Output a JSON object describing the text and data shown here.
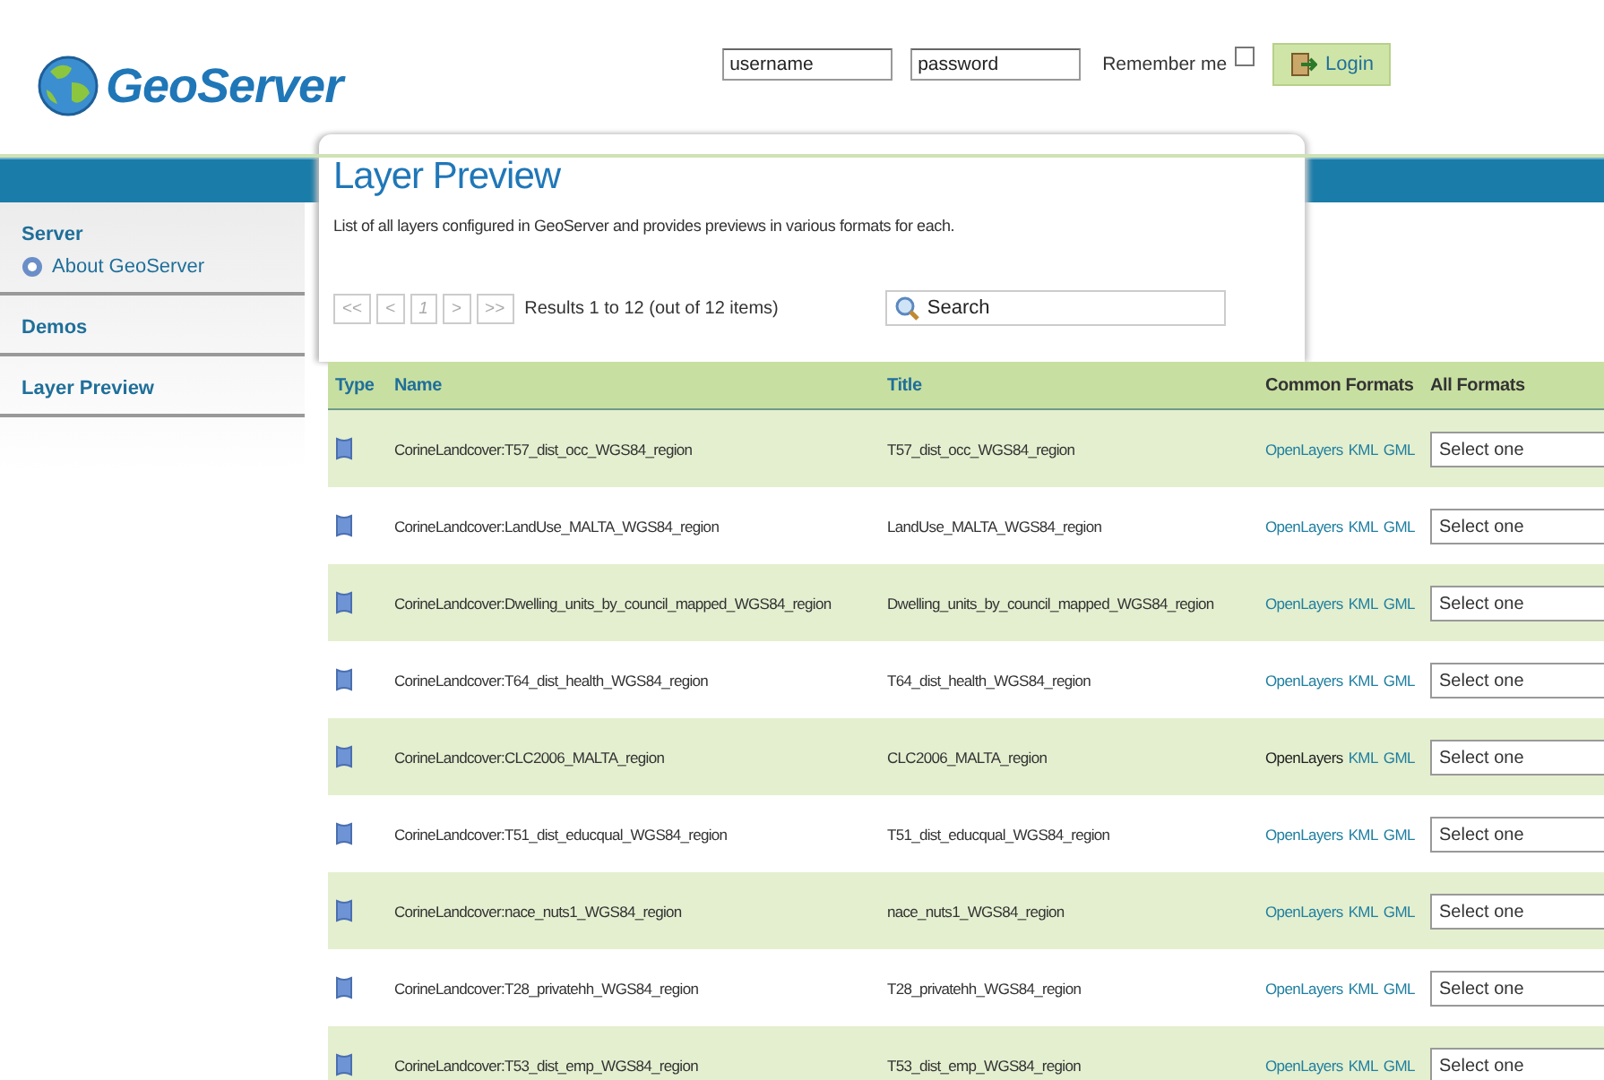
{
  "logo": {
    "text": "GeoServer"
  },
  "login": {
    "username": {
      "placeholder": "username"
    },
    "password": {
      "placeholder": "password"
    },
    "remember": {
      "label": "Remember me",
      "checked": false
    },
    "button": "Login"
  },
  "sidebar": {
    "sections": [
      {
        "title": "Server",
        "items": [
          {
            "label": "About GeoServer"
          }
        ]
      },
      {
        "title": "Demos"
      },
      {
        "title": "Layer Preview"
      }
    ]
  },
  "page": {
    "title": "Layer Preview",
    "description": "List of all layers configured in GeoServer and provides previews in various formats for each."
  },
  "pager": {
    "buttons": [
      {
        "label": "<<",
        "disabled": true
      },
      {
        "label": "<",
        "disabled": true
      },
      {
        "label": "1",
        "disabled": true
      },
      {
        "label": ">",
        "disabled": true
      },
      {
        "label": ">>",
        "disabled": true
      }
    ],
    "summary": "Results 1 to 12 (out of 12 items)"
  },
  "search": {
    "placeholder": "Search"
  },
  "table": {
    "columns": [
      {
        "label": "Type",
        "kind": "link"
      },
      {
        "label": "Name",
        "kind": "link"
      },
      {
        "label": "Title",
        "kind": "link"
      },
      {
        "label": "Common Formats",
        "kind": "label"
      },
      {
        "label": "All Formats",
        "kind": "label"
      }
    ],
    "rows": [
      {
        "name": "CorineLandcover:T57_dist_occ_WGS84_region",
        "title": "T57_dist_occ_WGS84_region",
        "formats": [
          {
            "label": "OpenLayers",
            "disabled": false
          },
          {
            "label": "KML",
            "disabled": false
          },
          {
            "label": "GML",
            "disabled": false
          }
        ],
        "select": "Select one"
      },
      {
        "name": "CorineLandcover:LandUse_MALTA_WGS84_region",
        "title": "LandUse_MALTA_WGS84_region",
        "formats": [
          {
            "label": "OpenLayers",
            "disabled": false
          },
          {
            "label": "KML",
            "disabled": false
          },
          {
            "label": "GML",
            "disabled": false
          }
        ],
        "select": "Select one"
      },
      {
        "name": "CorineLandcover:Dwelling_units_by_council_mapped_WGS84_region",
        "title": "Dwelling_units_by_council_mapped_WGS84_region",
        "formats": [
          {
            "label": "OpenLayers",
            "disabled": false
          },
          {
            "label": "KML",
            "disabled": false
          },
          {
            "label": "GML",
            "disabled": false
          }
        ],
        "select": "Select one"
      },
      {
        "name": "CorineLandcover:T64_dist_health_WGS84_region",
        "title": "T64_dist_health_WGS84_region",
        "formats": [
          {
            "label": "OpenLayers",
            "disabled": false
          },
          {
            "label": "KML",
            "disabled": false
          },
          {
            "label": "GML",
            "disabled": false
          }
        ],
        "select": "Select one"
      },
      {
        "name": "CorineLandcover:CLC2006_MALTA_region",
        "title": "CLC2006_MALTA_region",
        "formats": [
          {
            "label": "OpenLayers",
            "disabled": true
          },
          {
            "label": "KML",
            "disabled": false
          },
          {
            "label": "GML",
            "disabled": false
          }
        ],
        "select": "Select one"
      },
      {
        "name": "CorineLandcover:T51_dist_educqual_WGS84_region",
        "title": "T51_dist_educqual_WGS84_region",
        "formats": [
          {
            "label": "OpenLayers",
            "disabled": false
          },
          {
            "label": "KML",
            "disabled": false
          },
          {
            "label": "GML",
            "disabled": false
          }
        ],
        "select": "Select one"
      },
      {
        "name": "CorineLandcover:nace_nuts1_WGS84_region",
        "title": "nace_nuts1_WGS84_region",
        "formats": [
          {
            "label": "OpenLayers",
            "disabled": false
          },
          {
            "label": "KML",
            "disabled": false
          },
          {
            "label": "GML",
            "disabled": false
          }
        ],
        "select": "Select one"
      },
      {
        "name": "CorineLandcover:T28_privatehh_WGS84_region",
        "title": "T28_privatehh_WGS84_region",
        "formats": [
          {
            "label": "OpenLayers",
            "disabled": false
          },
          {
            "label": "KML",
            "disabled": false
          },
          {
            "label": "GML",
            "disabled": false
          }
        ],
        "select": "Select one"
      },
      {
        "name": "CorineLandcover:T53_dist_emp_WGS84_region",
        "title": "T53_dist_emp_WGS84_region",
        "formats": [
          {
            "label": "OpenLayers",
            "disabled": false
          },
          {
            "label": "KML",
            "disabled": false
          },
          {
            "label": "GML",
            "disabled": false
          }
        ],
        "select": "Select one"
      }
    ]
  }
}
